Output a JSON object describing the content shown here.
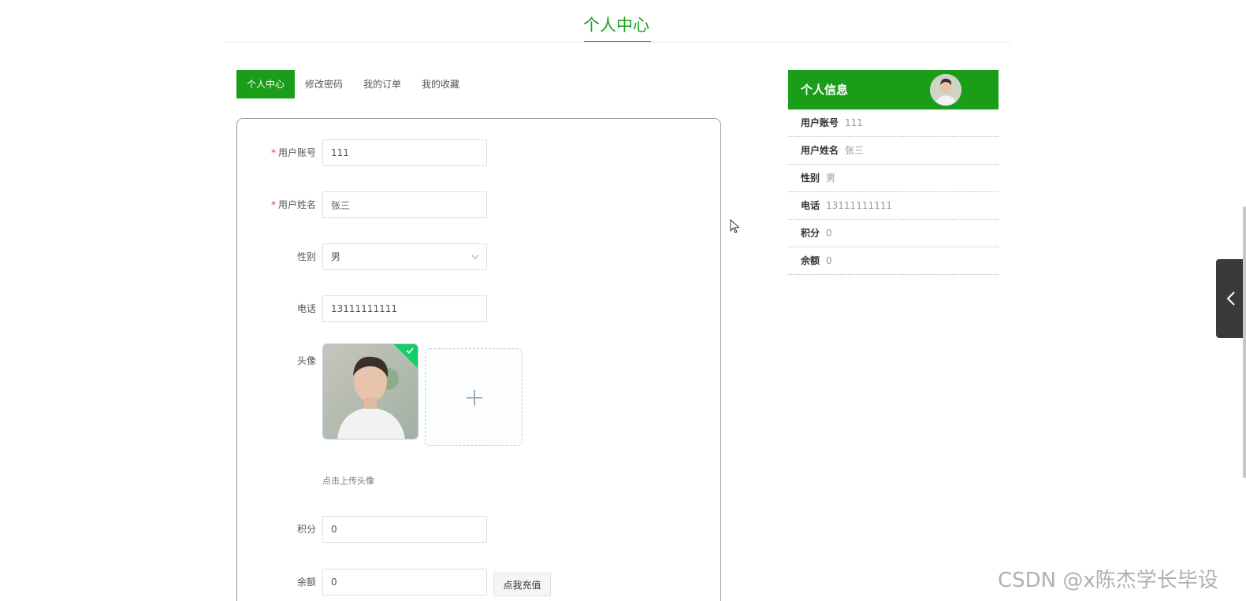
{
  "page": {
    "title": "个人中心"
  },
  "tabs": [
    {
      "label": "个人中心",
      "active": true
    },
    {
      "label": "修改密码",
      "active": false
    },
    {
      "label": "我的订单",
      "active": false
    },
    {
      "label": "我的收藏",
      "active": false
    }
  ],
  "form": {
    "username": {
      "label": "用户账号",
      "value": "111",
      "required": true
    },
    "realname": {
      "label": "用户姓名",
      "value": "张三",
      "required": true
    },
    "gender": {
      "label": "性别",
      "value": "男"
    },
    "phone": {
      "label": "电话",
      "value": "13111111111"
    },
    "avatar": {
      "label": "头像",
      "upload_tip": "点击上传头像"
    },
    "points": {
      "label": "积分",
      "value": "0"
    },
    "balance": {
      "label": "余额",
      "value": "0",
      "recharge_label": "点我充值"
    }
  },
  "info": {
    "title": "个人信息",
    "items": [
      {
        "key": "用户账号",
        "value": "111"
      },
      {
        "key": "用户姓名",
        "value": "张三"
      },
      {
        "key": "性别",
        "value": "男"
      },
      {
        "key": "电话",
        "value": "13111111111"
      },
      {
        "key": "积分",
        "value": "0"
      },
      {
        "key": "余额",
        "value": "0"
      }
    ]
  },
  "watermark": "CSDN @x陈杰学长毕设",
  "colors": {
    "accent": "#1a9e1a",
    "required": "#e0483c",
    "upload_success": "#13ce66"
  },
  "icons": [
    "chevron-down-icon",
    "plus-icon",
    "check-icon",
    "chevron-left-icon",
    "cursor-icon"
  ]
}
